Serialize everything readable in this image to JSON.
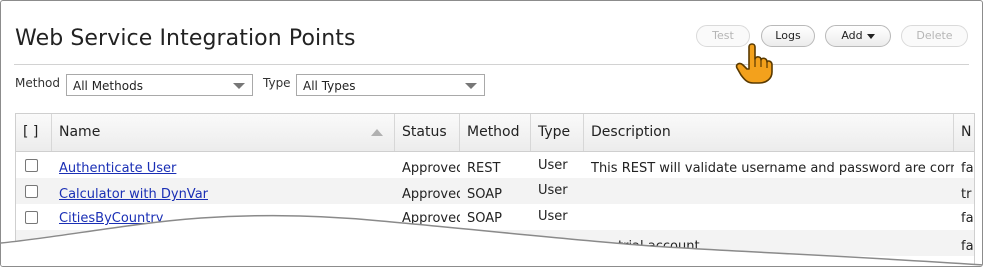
{
  "header": {
    "title": "Web Service Integration Points"
  },
  "toolbar": {
    "test_label": "Test",
    "logs_label": "Logs",
    "add_label": "Add",
    "delete_label": "Delete"
  },
  "filters": {
    "method_label": "Method",
    "method_value": "All Methods",
    "type_label": "Type",
    "type_value": "All Types"
  },
  "table": {
    "headers": {
      "select": "[ ]",
      "name": "Name",
      "status": "Status",
      "method": "Method",
      "type": "Type",
      "description": "Description",
      "next": "N"
    },
    "rows": [
      {
        "name": "Authenticate User",
        "status": "Approved",
        "method": "REST",
        "type": "User",
        "description": "This REST will validate username and password are correct",
        "next": "fa"
      },
      {
        "name": "Calculator with DynVar",
        "status": "Approved",
        "method": "SOAP",
        "type": "User",
        "description": "",
        "next": "tr"
      },
      {
        "name": "CitiesByCountry",
        "status": "Approved",
        "method": "SOAP",
        "type": "User",
        "description": "",
        "next": "fa"
      },
      {
        "name": "",
        "status": "",
        "method": "",
        "type": "",
        "description": "trial account",
        "next": "fa"
      }
    ]
  },
  "colors": {
    "link": "#1a2fb5",
    "pointer": "#f3a11c"
  }
}
